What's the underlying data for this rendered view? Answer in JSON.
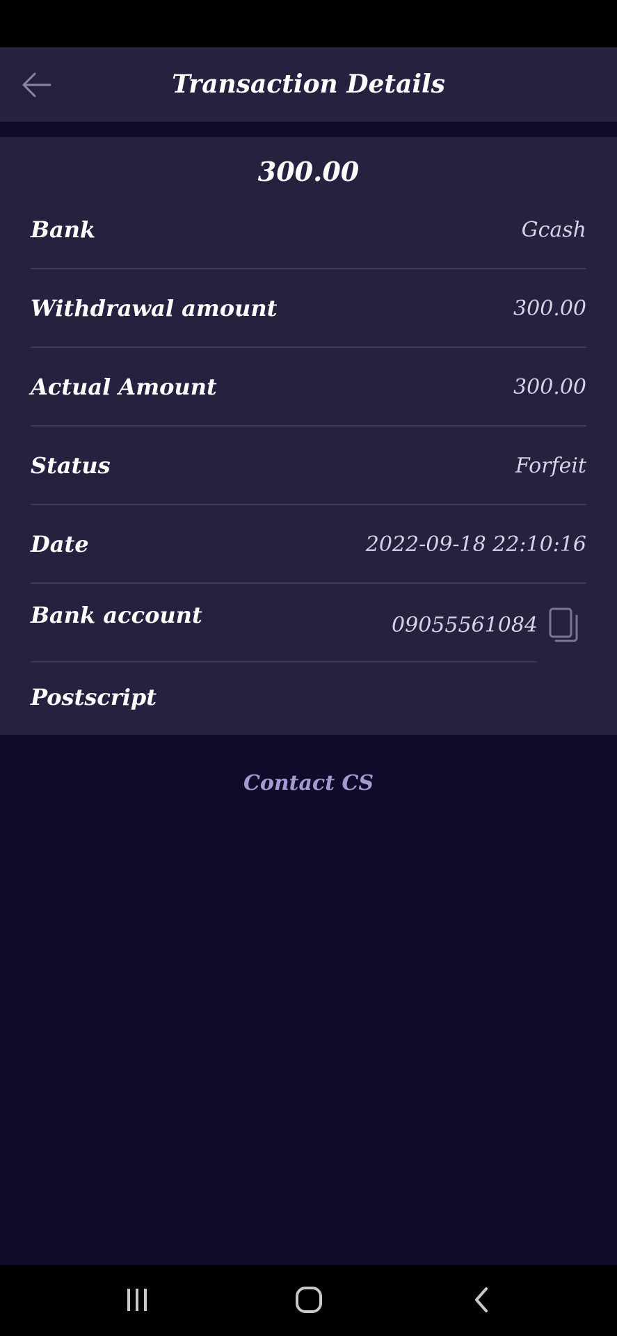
{
  "header": {
    "title": "Transaction Details"
  },
  "transaction": {
    "amount": "300.00",
    "rows": [
      {
        "label": "Bank",
        "value": "Gcash"
      },
      {
        "label": "Withdrawal amount",
        "value": "300.00"
      },
      {
        "label": "Actual Amount",
        "value": "300.00"
      },
      {
        "label": "Status",
        "value": "Forfeit"
      },
      {
        "label": "Date",
        "value": "2022-09-18 22:10:16"
      }
    ],
    "bank_account": {
      "label": "Bank account",
      "value": "09055561084"
    },
    "postscript": {
      "label": "Postscript"
    }
  },
  "contact": {
    "label": "Contact CS"
  },
  "colors": {
    "background": "#120a2b",
    "panel": "#25213f",
    "divider": "#3e3a5c",
    "accent": "#a69bd0"
  },
  "icons": {
    "back": "arrow-left-icon",
    "copy": "copy-icon",
    "nav_recents": "recents-icon",
    "nav_home": "home-icon",
    "nav_back": "chevron-left-icon"
  }
}
